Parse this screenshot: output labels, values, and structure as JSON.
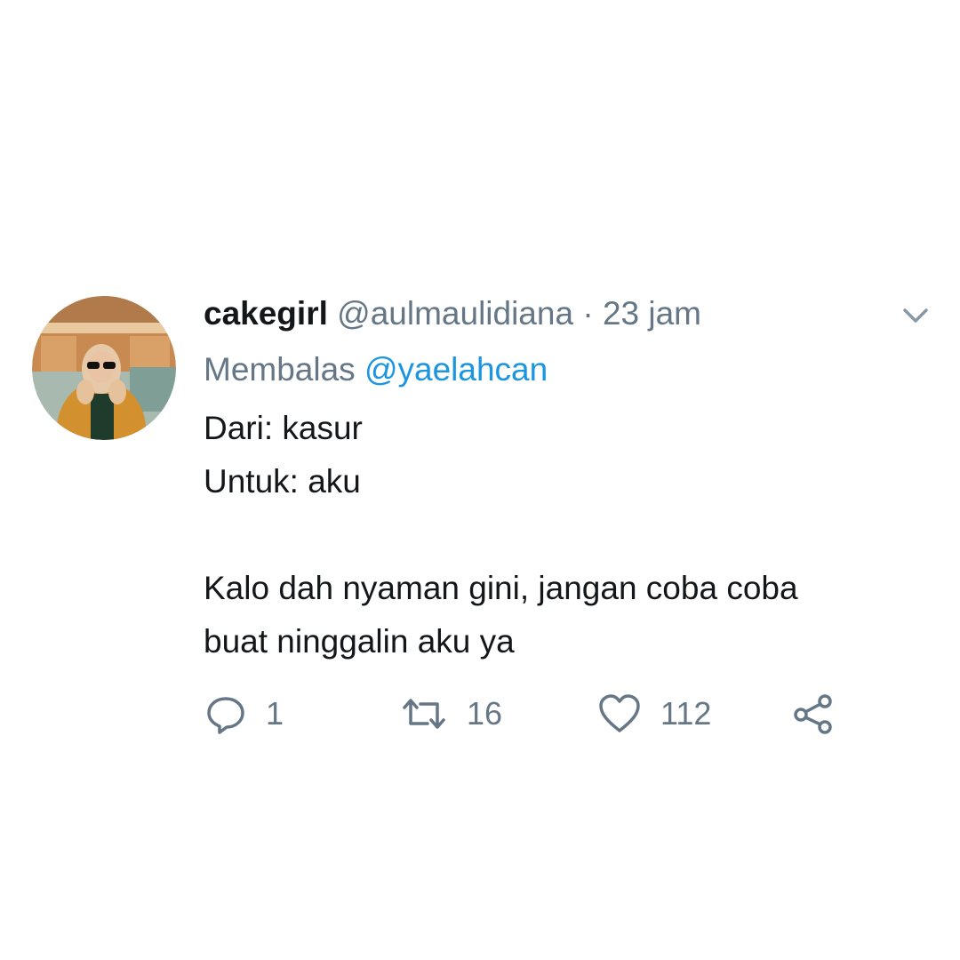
{
  "tweet": {
    "display_name": "cakegirl",
    "handle": "@aulmaulidiana",
    "separator": "·",
    "time": "23 jam",
    "reply_prefix": "Membalas",
    "reply_to": "@yaelahcan",
    "lines": [
      "Dari: kasur",
      "Untuk: aku",
      "Kalo dah nyaman gini, jangan coba coba",
      "buat ninggalin aku ya"
    ],
    "counts": {
      "replies": "1",
      "retweets": "16",
      "likes": "112"
    }
  },
  "icons": {
    "more": "chevron-down-icon",
    "reply": "reply-bubble-icon",
    "retweet": "retweet-icon",
    "like": "heart-icon",
    "share": "share-icon"
  },
  "colors": {
    "text_primary": "#14171a",
    "text_secondary": "#657786",
    "link": "#1b95e0",
    "background": "#ffffff"
  }
}
